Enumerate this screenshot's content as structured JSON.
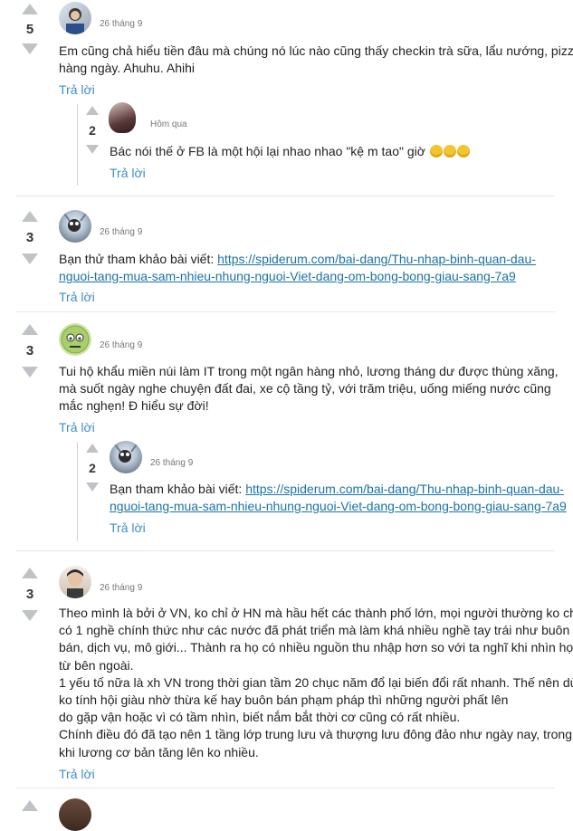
{
  "comments": [
    {
      "score": "5",
      "date": "26 tháng 9",
      "lines": [
        "Em cũng chả hiểu tiền đâu mà chúng nó lúc nào cũng thấy checkin trà sữa, lẩu nướng, pizza",
        "hàng ngày. Ahuhu. Ahihi"
      ],
      "reply_label": "Trả lời",
      "replies": [
        {
          "score": "2",
          "date": "Hôm qua",
          "text": "Bác nói thế ở FB là một hội lại nhao nhao \"kệ m   tao\" giờ",
          "emoji": [
            "face-with-tears-of-joy-icon",
            "face-with-tears-of-joy-icon",
            "face-with-tears-of-joy-icon"
          ],
          "reply_label": "Trả lời"
        }
      ]
    },
    {
      "score": "3",
      "date": "26 tháng 9",
      "prefix": "Bạn thử tham khảo bài viết: ",
      "link_line1": "https://spiderum.com/bai-dang/Thu-nhap-binh-quan-dau-",
      "link_line2": "nguoi-tang-mua-sam-nhieu-nhung-nguoi-Viet-dang-om-bong-bong-giau-sang-7a9",
      "reply_label": "Trả lời"
    },
    {
      "score": "3",
      "date": "26 tháng 9",
      "lines": [
        "Tui hộ khẩu miền núi làm IT trong một ngân hàng nhỏ, lương tháng dư được thùng xăng,",
        "mà suốt ngày nghe  chuyện đất đai, xe cộ tầng tỷ, với trăm triệu, uống miếng nước cũng",
        "mắc nghẹn! Đ     hiểu sự đời!"
      ],
      "reply_label": "Trả lời",
      "replies": [
        {
          "score": "2",
          "date": "26 tháng 9",
          "prefix": "Bạn tham khảo bài viết: ",
          "link_line1": "https://spiderum.com/bai-dang/Thu-nhap-binh-quan-dau-",
          "link_line2": "nguoi-tang-mua-sam-nhieu-nhung-nguoi-Viet-dang-om-bong-bong-giau-sang-7a9",
          "reply_label": "Trả lời"
        }
      ]
    },
    {
      "score": "3",
      "date": "26 tháng 9",
      "lines": [
        "Theo mình là bởi ở VN, ko chỉ ở HN mà hầu hết các thành phố lớn, mọi người thường ko chỉ",
        "có 1 nghề chính thức như các nước đã phát triển mà làm khá nhiều nghề tay trái như buôn",
        "bán, dịch vụ, mô giới... Thành ra họ có nhiều nguồn thu nhập hơn so với ta nghĩ khi nhìn họ",
        "từ bên ngoài.",
        "1 yếu tố nữa là xh VN trong thời gian tầm 20 chục năm đổ lại biến đổi rất nhanh. Thế nên dù",
        "ko tính hội giàu nhờ thừa kế               hay buôn bán phạm pháp thì những người phất lên",
        "do gặp vận hoặc vì có tầm nhìn, biết nắm bắt thời cơ cũng có rất nhiều.",
        "Chính điều đó đã tạo nên 1 tầng lớp trung lưu và thượng lưu đông đảo như ngày nay, trong",
        "khi lương cơ bản tăng lên ko nhiều."
      ],
      "reply_label": "Trả lời"
    }
  ]
}
